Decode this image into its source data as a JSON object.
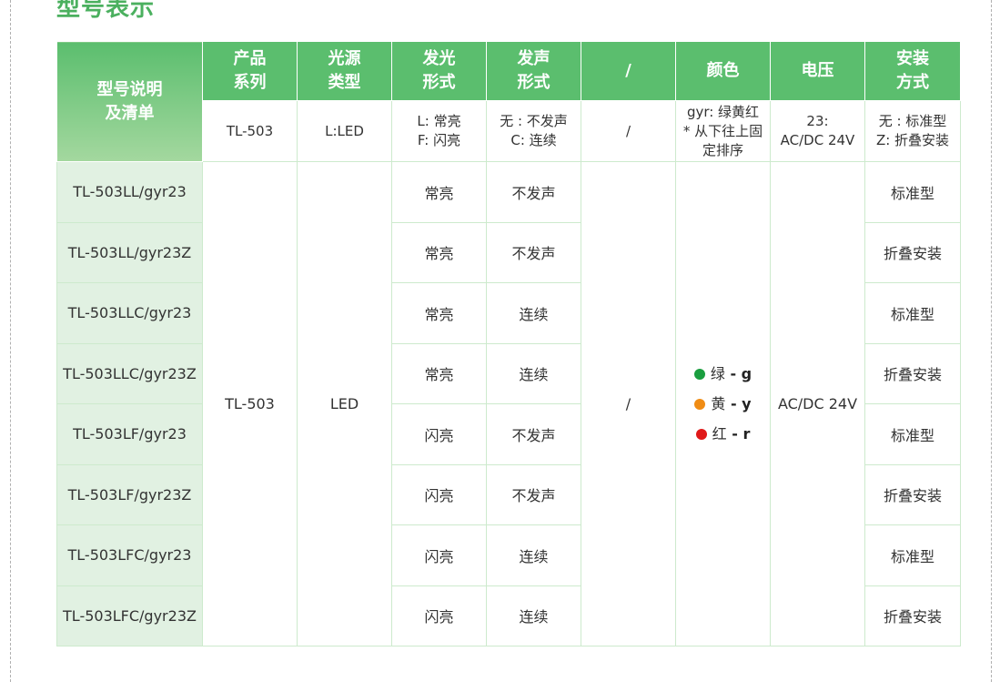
{
  "title": "型号表示",
  "header": {
    "corner": [
      "型号说明",
      "及清单"
    ],
    "cols": [
      [
        "产品",
        "系列"
      ],
      [
        "光源",
        "类型"
      ],
      [
        "发光",
        "形式"
      ],
      [
        "发声",
        "形式"
      ],
      [
        "/"
      ],
      [
        "颜色"
      ],
      [
        "电压"
      ],
      [
        "安装",
        "方式"
      ]
    ]
  },
  "legend_row": {
    "series": "TL-503",
    "source": "L:LED",
    "light": [
      "L: 常亮",
      "F: 闪亮"
    ],
    "sound": [
      "无 : 不发声",
      "C: 连续"
    ],
    "slash": "/",
    "color": [
      "gyr: 绿黄红",
      "* 从下往上固",
      "定排序"
    ],
    "voltage": [
      "23:",
      "AC/DC 24V"
    ],
    "mount": [
      "无 : 标准型",
      "Z: 折叠安装"
    ]
  },
  "merged": {
    "series": "TL-503",
    "source": "LED",
    "slash": "/",
    "voltage": "AC/DC 24V"
  },
  "colors": [
    {
      "name": "绿",
      "sep": " - ",
      "code": "g",
      "hex": "#1a9e3f"
    },
    {
      "name": "黄",
      "sep": " - ",
      "code": "y",
      "hex": "#f08c14"
    },
    {
      "name": "红",
      "sep": " - ",
      "code": "r",
      "hex": "#e01919"
    }
  ],
  "rows": [
    {
      "model": "TL-503LL/gyr23",
      "light": "常亮",
      "sound": "不发声",
      "mount": "标准型"
    },
    {
      "model": "TL-503LL/gyr23Z",
      "light": "常亮",
      "sound": "不发声",
      "mount": "折叠安装"
    },
    {
      "model": "TL-503LLC/gyr23",
      "light": "常亮",
      "sound": "连续",
      "mount": "标准型"
    },
    {
      "model": "TL-503LLC/gyr23Z",
      "light": "常亮",
      "sound": "连续",
      "mount": "折叠安装"
    },
    {
      "model": "TL-503LF/gyr23",
      "light": "闪亮",
      "sound": "不发声",
      "mount": "标准型"
    },
    {
      "model": "TL-503LF/gyr23Z",
      "light": "闪亮",
      "sound": "不发声",
      "mount": "折叠安装"
    },
    {
      "model": "TL-503LFC/gyr23",
      "light": "闪亮",
      "sound": "连续",
      "mount": "标准型"
    },
    {
      "model": "TL-503LFC/gyr23Z",
      "light": "闪亮",
      "sound": "连续",
      "mount": "折叠安装"
    }
  ]
}
